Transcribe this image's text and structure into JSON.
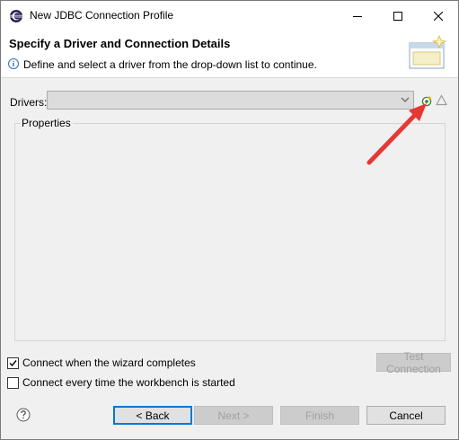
{
  "window": {
    "title": "New JDBC Connection Profile",
    "app_icon": "eclipse-icon"
  },
  "header": {
    "title": "Specify a Driver and Connection Details",
    "message": "Define and select a driver from the drop-down list to continue.",
    "message_icon": "info-icon",
    "banner_icon": "wizard-banner-icon"
  },
  "drivers": {
    "label": "Drivers:",
    "selected": "",
    "new_driver_icon": "new-driver-icon",
    "edit_driver_icon": "edit-driver-icon"
  },
  "properties": {
    "title": "Properties"
  },
  "test_connection": {
    "label": "Test Connection",
    "enabled": false
  },
  "options": [
    {
      "label": "Connect when the wizard completes",
      "checked": true
    },
    {
      "label": "Connect every time the workbench is started",
      "checked": false
    }
  ],
  "footer": {
    "help_icon": "help-icon",
    "back_label": "< Back",
    "next_label": "Next >",
    "finish_label": "Finish",
    "cancel_label": "Cancel"
  },
  "colors": {
    "annotation_arrow": "#e53935",
    "default_button_border": "#0078d7"
  }
}
